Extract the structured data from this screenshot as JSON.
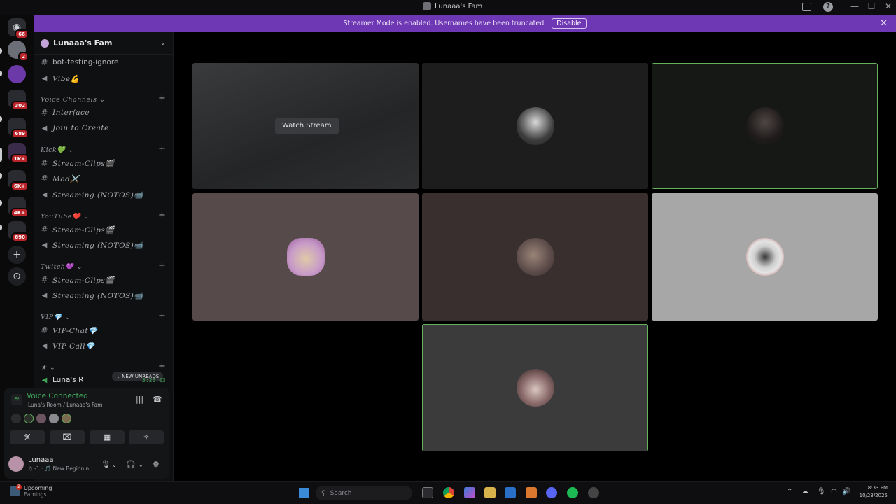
{
  "window": {
    "title": "Lunaaa's Fam",
    "inbox_icon": "inbox-icon",
    "help_icon": "?",
    "minimize": "—",
    "maximize": "☐",
    "close": "✕"
  },
  "rail": {
    "servers": [
      {
        "name": "home",
        "badge": "66"
      },
      {
        "name": "server-1",
        "badge": "2"
      },
      {
        "name": "server-2",
        "badge": ""
      },
      {
        "name": "folder-1",
        "badge": "302"
      },
      {
        "name": "folder-2",
        "badge": "689"
      },
      {
        "name": "folder-3",
        "badge": "1K+"
      },
      {
        "name": "folder-4",
        "badge": "6K+"
      },
      {
        "name": "folder-5",
        "badge": "4K+"
      },
      {
        "name": "folder-6",
        "badge": "890"
      }
    ],
    "add_server_icon": "+",
    "discover_icon": "⊙"
  },
  "banner": {
    "message": "Streamer Mode is enabled. Usernames have been truncated.",
    "disable_label": "Disable",
    "close_icon": "✕"
  },
  "guild": {
    "name": "Lunaaa's Fam",
    "chevron": "⌄"
  },
  "channels": {
    "bot_testing": "bot-testing-ignore",
    "vibe": "Vibe💪",
    "cat_voice": "Voice Channels ⌄",
    "interface": "Interface",
    "join_to_create": "Join to Create",
    "cat_kick": "Kick💚 ⌄",
    "kick_clips": "Stream-Clips🎬",
    "kick_mod": "Mod⚔️",
    "kick_streaming": "Streaming (NOTOS)📹",
    "cat_youtube": "YouTube❤️ ⌄",
    "yt_clips": "Stream-Clips🎬",
    "yt_streaming": "Streaming (NOTOS)📹",
    "cat_twitch": "Twitch💜 ⌄",
    "tw_clips": "Stream-Clips🎬",
    "tw_streaming": "Streaming (NOTOS)📹",
    "cat_vip": "VIP💎 ⌄",
    "vip_chat": "VIP-Chat💎",
    "vip_call": "VIP Call💎",
    "cat_star": "★ ⌄",
    "lunas_room": "Luna's R",
    "new_unreads": "⌄ NEW UNREADS",
    "timer": "3:25:03"
  },
  "voice": {
    "status": "Voice Connected",
    "location": "Luna's Room / Lunaaa's Fam",
    "buttons": [
      "✎̸",
      "⌧",
      "▦",
      "✧"
    ]
  },
  "user": {
    "name": "Lunaaa",
    "status": "♫ -1 · 🎵 New Beginnin..."
  },
  "stage": {
    "watch_label": "Watch Stream"
  },
  "taskbar": {
    "widget_title": "Upcoming",
    "widget_sub": "Earnings",
    "widget_badge": "2",
    "search_placeholder": "Search",
    "time": "8:33 PM",
    "date": "10/23/2025"
  },
  "colors": {
    "banner": "#6e37b3",
    "speaking": "#67b15e",
    "voice_connected": "#3fa45a"
  }
}
